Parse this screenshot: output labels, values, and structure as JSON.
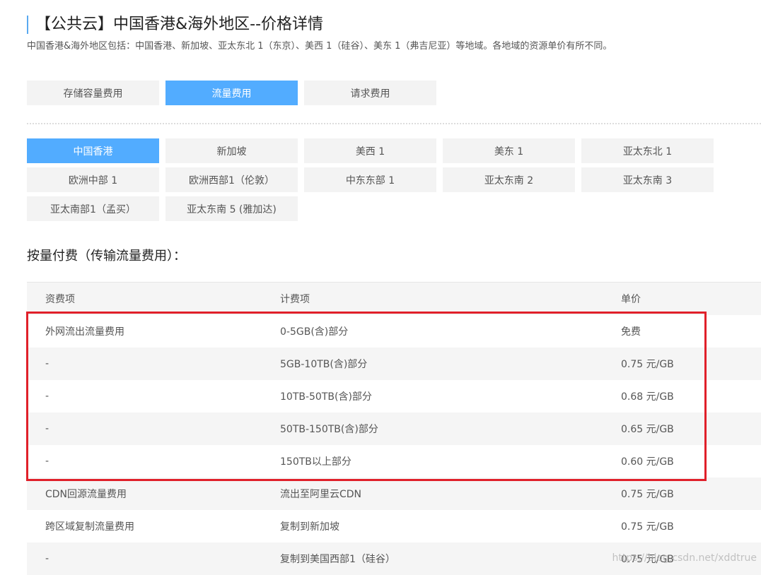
{
  "header": {
    "title": "【公共云】中国香港&海外地区--价格详情",
    "description": "中国香港&海外地区包括：中国香港、新加坡、亚太东北 1（东京）、美西 1（硅谷）、美东 1（弗吉尼亚）等地域。各地域的资源单价有所不同。"
  },
  "fee_tabs": [
    {
      "label": "存储容量费用",
      "active": false
    },
    {
      "label": "流量费用",
      "active": true
    },
    {
      "label": "请求费用",
      "active": false
    }
  ],
  "regions": [
    {
      "label": "中国香港",
      "active": true
    },
    {
      "label": "新加坡"
    },
    {
      "label": "美西 1"
    },
    {
      "label": "美东 1"
    },
    {
      "label": "亚太东北 1"
    },
    {
      "label": "欧洲中部 1"
    },
    {
      "label": "欧洲西部1（伦敦）"
    },
    {
      "label": "中东东部 1"
    },
    {
      "label": "亚太东南 2"
    },
    {
      "label": "亚太东南 3"
    },
    {
      "label": "亚太南部1（孟买）"
    },
    {
      "label": "亚太东南 5 (雅加达)"
    }
  ],
  "section_title": "按量付费（传输流量费用）：",
  "table": {
    "headers": [
      "资费项",
      "计费项",
      "单价"
    ],
    "rows": [
      [
        "外网流出流量费用",
        "0-5GB(含)部分",
        "免费"
      ],
      [
        "-",
        "5GB-10TB(含)部分",
        "0.75 元/GB"
      ],
      [
        "-",
        "10TB-50TB(含)部分",
        "0.68 元/GB"
      ],
      [
        "-",
        "50TB-150TB(含)部分",
        "0.65 元/GB"
      ],
      [
        "-",
        "150TB以上部分",
        "0.60 元/GB"
      ],
      [
        "CDN回源流量费用",
        "流出至阿里云CDN",
        "0.75 元/GB"
      ],
      [
        "跨区域复制流量费用",
        "复制到新加坡",
        "0.75 元/GB"
      ],
      [
        "-",
        "复制到美国西部1（硅谷）",
        "0.75 元/GB"
      ]
    ]
  },
  "highlight_color": "#e0202a",
  "watermark": "https://blog.csdn.net/xddtrue"
}
